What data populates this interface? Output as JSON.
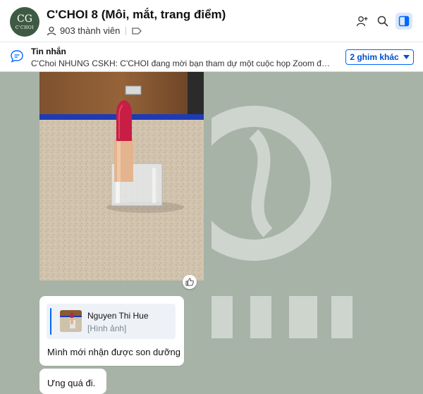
{
  "header": {
    "group_name": "C'CHOI 8 (Môi, mắt, trang điểm)",
    "member_count": "903 thành viên",
    "avatar_text": "C'CHOI",
    "avatar_mono": "CG",
    "icons": [
      "add-member-icon",
      "search-icon",
      "sidebar-toggle-icon"
    ]
  },
  "pinned": {
    "label": "Tin nhắn",
    "text": "C'Choi NHUNG CSKH: C'CHOI đang mời bạn tham dự một cuộc họp Zoom được lên lịc...",
    "more_button": "2 ghim khác"
  },
  "messages": [
    {
      "type": "image",
      "description_icon": "thumbs-up-icon"
    },
    {
      "type": "reply",
      "quote": {
        "author": "Nguyen Thi Hue",
        "kind": "[Hình ảnh]"
      },
      "text": "Mình mới nhận được son dưỡng"
    },
    {
      "type": "text",
      "text": "Ưng quá đi."
    }
  ],
  "colors": {
    "accent": "#0068ff",
    "chat_background": "#a7b3a7",
    "lipstick": "#c81d44"
  }
}
